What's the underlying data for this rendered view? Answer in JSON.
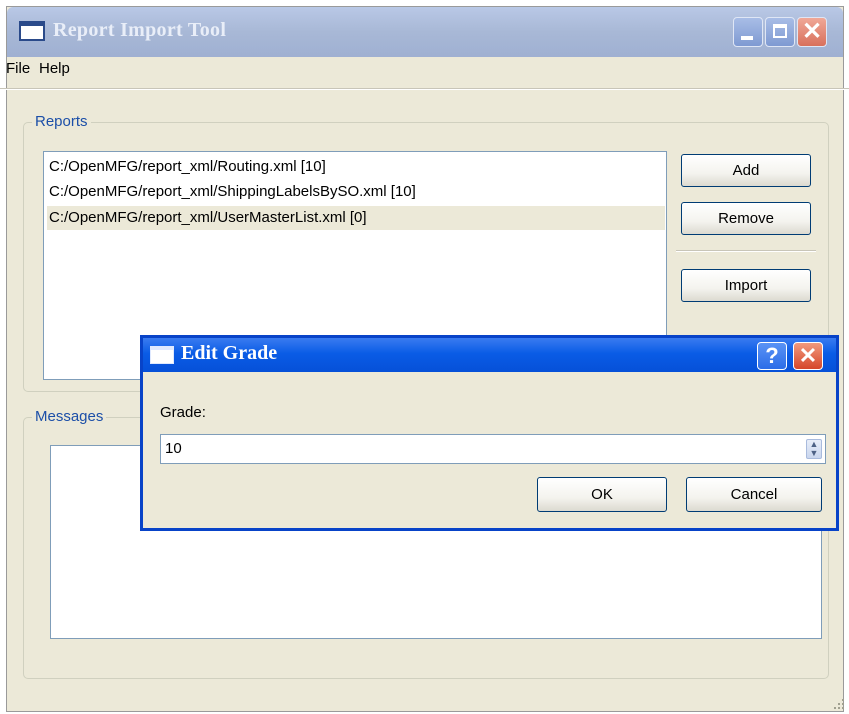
{
  "window": {
    "title": "Report Import Tool",
    "minimize_icon": "minimize-icon",
    "maximize_icon": "maximize-icon",
    "close_glyph": "✕"
  },
  "menu": [
    {
      "label": "File"
    },
    {
      "label": "Help"
    }
  ],
  "reports": {
    "group_title": "Reports",
    "items": [
      {
        "label": "C:/OpenMFG/report_xml/Routing.xml [10]",
        "selected": false
      },
      {
        "label": "C:/OpenMFG/report_xml/ShippingLabelsBySO.xml [10]",
        "selected": false
      },
      {
        "label": "C:/OpenMFG/report_xml/UserMasterList.xml [0]",
        "selected": true
      }
    ],
    "buttons": {
      "add": "Add",
      "remove": "Remove",
      "import": "Import"
    }
  },
  "messages": {
    "group_title": "Messages"
  },
  "dialog": {
    "title": "Edit Grade",
    "help_glyph": "?",
    "close_glyph": "✕",
    "grade_label": "Grade:",
    "grade_value": "10",
    "spin_glyph": "▲▼",
    "ok": "OK",
    "cancel": "Cancel"
  },
  "colors": {
    "window_bg": "#ece9d8",
    "dialog_titlebar": "#0a5ce6",
    "group_title": "#1c4fa8"
  }
}
